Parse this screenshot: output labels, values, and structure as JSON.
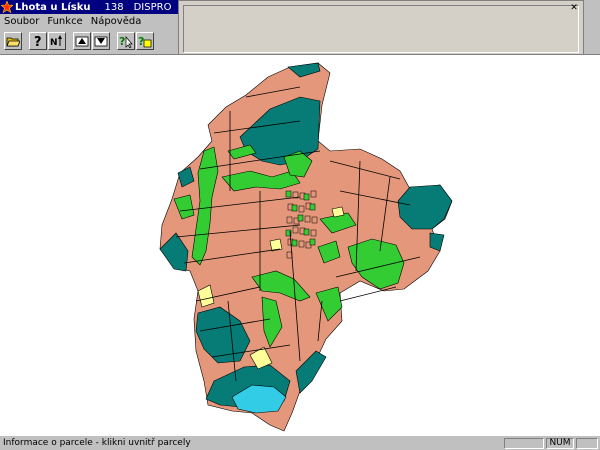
{
  "window": {
    "title": "Lhota u Lísku",
    "code": "138",
    "system": "DISPRO"
  },
  "menu": [
    {
      "label": "Soubor"
    },
    {
      "label": "Funkce"
    },
    {
      "label": "Nápověda"
    }
  ],
  "toolbar": {
    "buttons": [
      {
        "icon": "open-folder-icon"
      },
      {
        "icon": "help-query-icon"
      },
      {
        "icon": "north-arrow-icon"
      },
      {
        "icon": "zoom-in-icon"
      },
      {
        "icon": "zoom-out-icon"
      },
      {
        "icon": "parcel-info-icon"
      },
      {
        "icon": "parcel-search-icon"
      }
    ]
  },
  "status": {
    "text": "Informace o parcele - klikni uvnitř parcely",
    "indicator": "NUM"
  },
  "colors": {
    "titlebar": "#000080",
    "arable": "#E4977A",
    "grassland": "#33CC33",
    "forest": "#077B75",
    "water": "#33CCE6",
    "other": "#FFFF99",
    "boundary": "#000000"
  }
}
